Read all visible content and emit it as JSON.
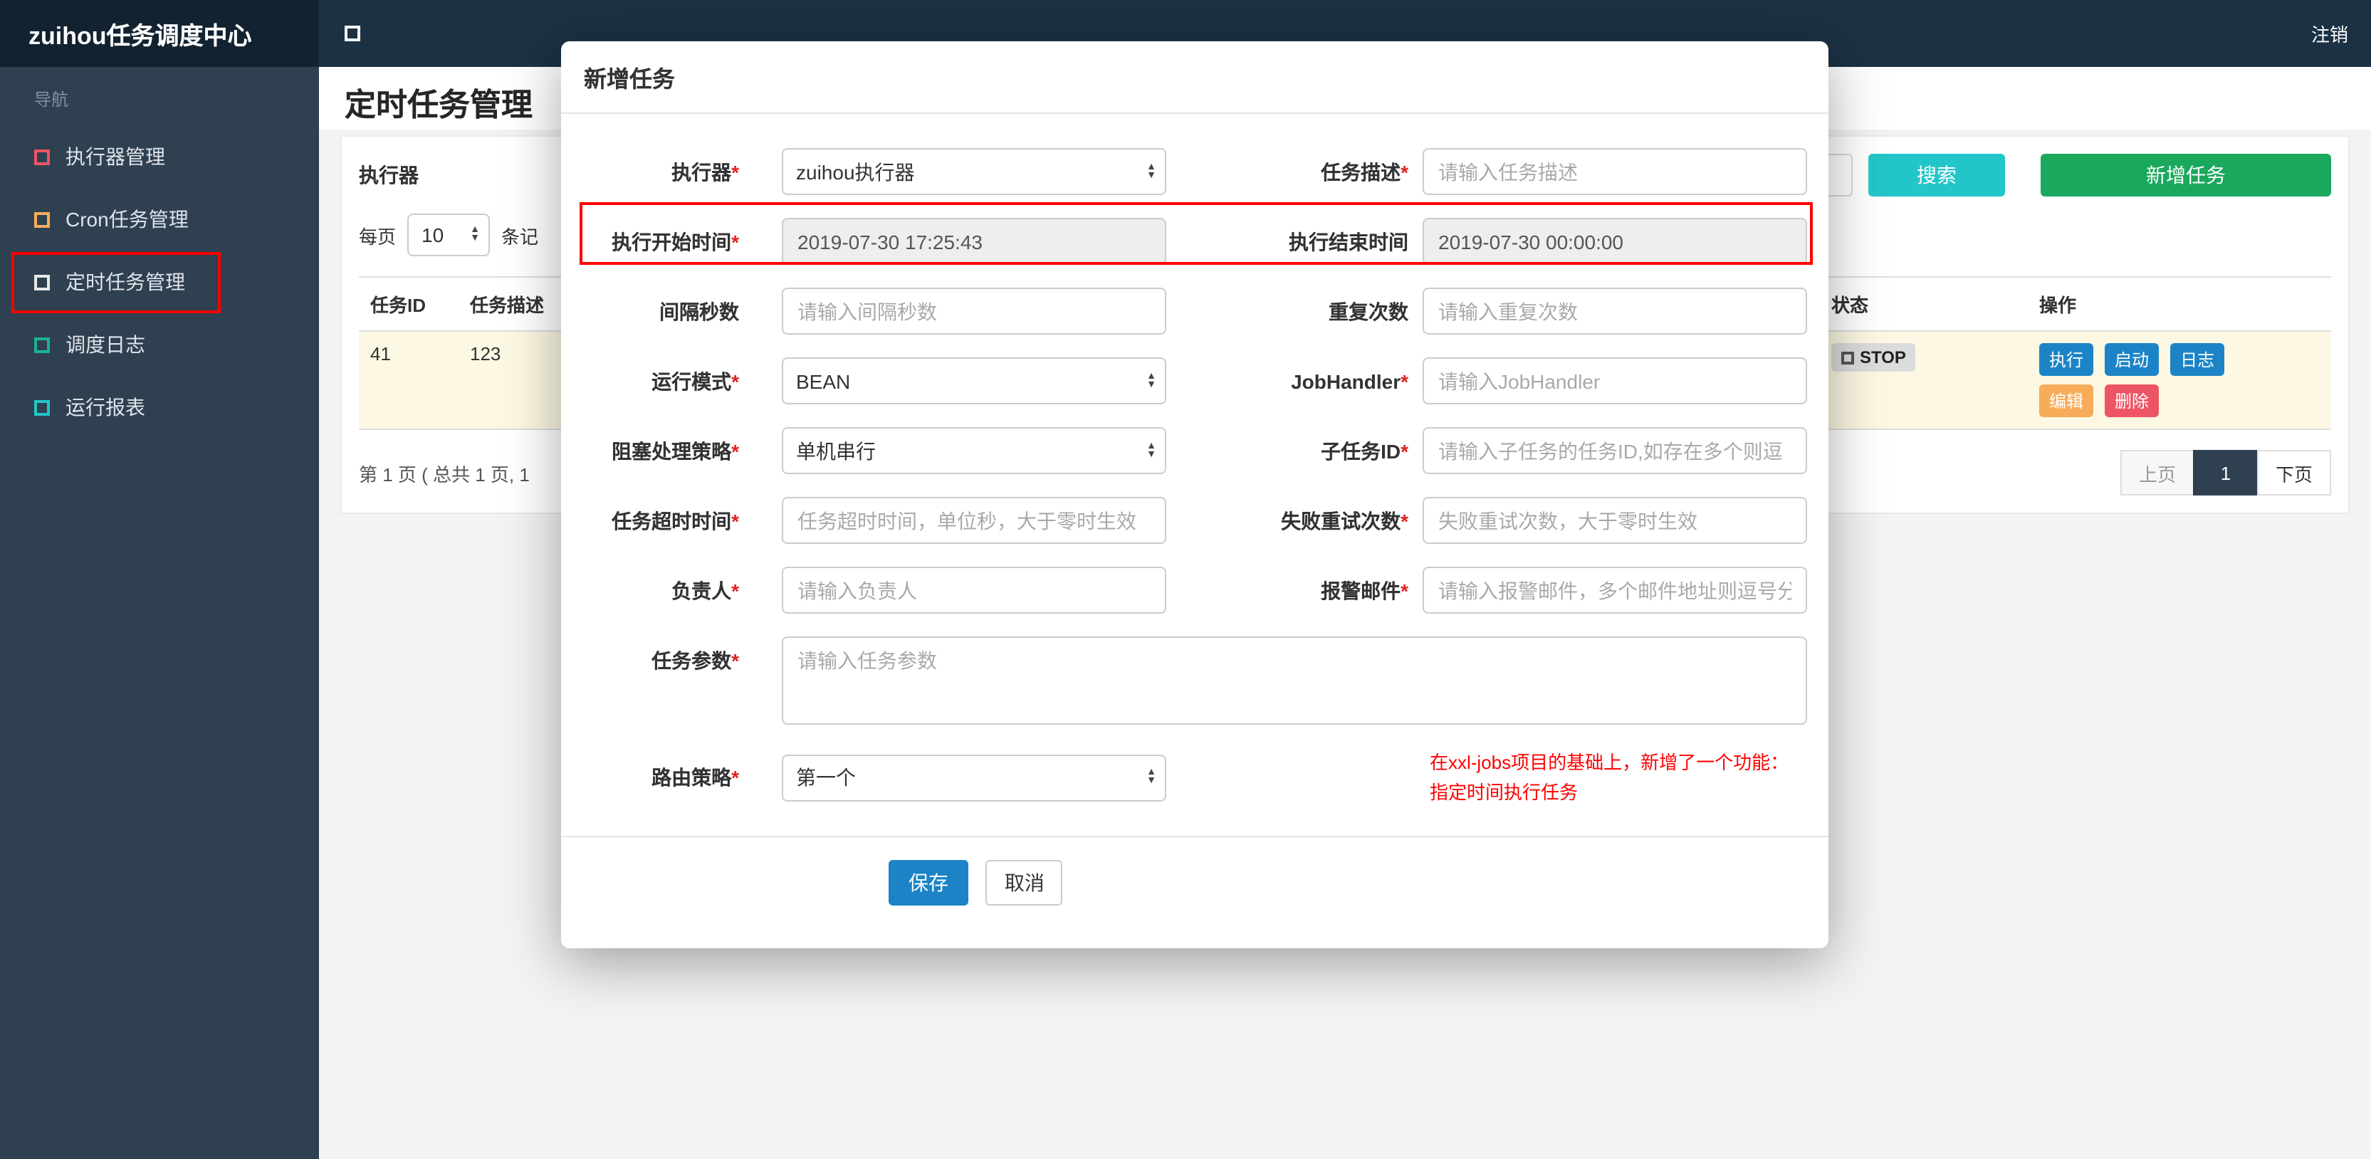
{
  "navbar": {
    "brand": "zuihou任务调度中心",
    "logout": "注销"
  },
  "sidebar": {
    "section_label": "导航",
    "items": [
      {
        "label": "执行器管理",
        "icon_color": "#ed5565"
      },
      {
        "label": "Cron任务管理",
        "icon_color": "#f8ac59"
      },
      {
        "label": "定时任务管理",
        "icon_color": "#e8e8e8"
      },
      {
        "label": "调度日志",
        "icon_color": "#1ab394"
      },
      {
        "label": "运行报表",
        "icon_color": "#23c6c8"
      }
    ]
  },
  "page": {
    "title": "定时任务管理",
    "toolbar": {
      "executor_label": "执行器",
      "search_button": "搜索",
      "add_button": "新增任务"
    },
    "per_page": {
      "prefix": "每页",
      "value": "10",
      "suffix": "条记"
    },
    "table": {
      "headers": [
        "任务ID",
        "任务描述",
        "状态",
        "操作"
      ],
      "row": {
        "job_id": "41",
        "job_desc": "123",
        "status": "STOP",
        "actions": [
          {
            "label": "执行",
            "color": "#1c84c6"
          },
          {
            "label": "启动",
            "color": "#1c84c6"
          },
          {
            "label": "日志",
            "color": "#1c84c6"
          },
          {
            "label": "编辑",
            "color": "#f8ac59"
          },
          {
            "label": "删除",
            "color": "#ed5565"
          }
        ]
      }
    },
    "pagination": {
      "summary": "第 1 页 ( 总共 1 页, 1",
      "prev": "上页",
      "current": "1",
      "next": "下页"
    }
  },
  "modal": {
    "title": "新增任务",
    "required_mark": "*",
    "executor": {
      "label": "执行器",
      "value": "zuihou执行器"
    },
    "job_desc": {
      "label": "任务描述",
      "placeholder": "请输入任务描述"
    },
    "start_time": {
      "label": "执行开始时间",
      "value": "2019-07-30 17:25:43"
    },
    "end_time": {
      "label": "执行结束时间",
      "value": "2019-07-30 00:00:00"
    },
    "interval": {
      "label": "间隔秒数",
      "placeholder": "请输入间隔秒数"
    },
    "repeat": {
      "label": "重复次数",
      "placeholder": "请输入重复次数"
    },
    "glue_type": {
      "label": "运行模式",
      "value": "BEAN"
    },
    "job_handler": {
      "label": "JobHandler",
      "placeholder": "请输入JobHandler"
    },
    "block_strategy": {
      "label": "阻塞处理策略",
      "value": "单机串行"
    },
    "child_job": {
      "label": "子任务ID",
      "placeholder": "请输入子任务的任务ID,如存在多个则逗"
    },
    "timeout": {
      "label": "任务超时时间",
      "placeholder": "任务超时时间，单位秒，大于零时生效"
    },
    "retry": {
      "label": "失败重试次数",
      "placeholder": "失败重试次数，大于零时生效"
    },
    "owner": {
      "label": "负责人",
      "placeholder": "请输入负责人"
    },
    "alarm_email": {
      "label": "报警邮件",
      "placeholder": "请输入报警邮件，多个邮件地址则逗号分"
    },
    "job_param": {
      "label": "任务参数",
      "placeholder": "请输入任务参数"
    },
    "route_strategy": {
      "label": "路由策略",
      "value": "第一个"
    },
    "note_line1": "在xxl-jobs项目的基础上，新增了一个功能：",
    "note_line2": "指定时间执行任务",
    "save_button": "保存",
    "cancel_button": "取消"
  }
}
